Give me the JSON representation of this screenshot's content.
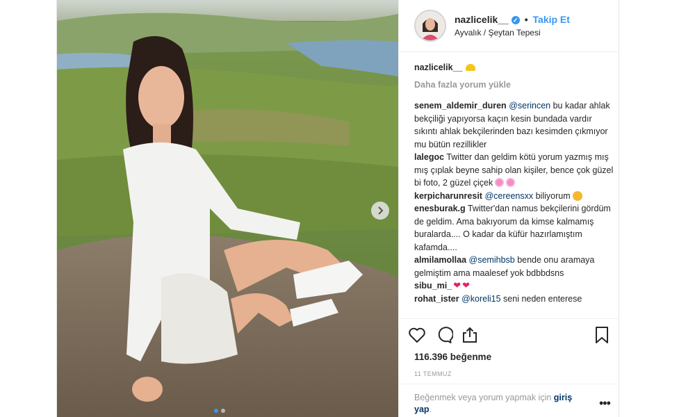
{
  "header": {
    "username": "nazlicelik__",
    "separator": "•",
    "follow_label": "Takip Et",
    "location": "Ayvalık / Şeytan Tepesi"
  },
  "caption": {
    "username": "nazlicelik__"
  },
  "load_more_label": "Daha fazla yorum yükle",
  "comments": [
    {
      "username": "senem_aldemir_duren",
      "mention": "@serincen",
      "text": " bu kadar ahlak bekçiliği yapıyorsa kaçın kesin bundada vardır sıkıntı ahlak bekçilerinden bazı kesimden çıkmıyor mu bütün rezillikler"
    },
    {
      "username": "lalegoc",
      "mention": "",
      "text": "Twitter dan geldim kötü yorum yazmış mış mış çıplak beyne sahip olan kişiler, bence çok güzel bi foto, 2 güzel çiçek"
    },
    {
      "username": "kerpicharunresit",
      "mention": "@cereensxx",
      "text": " biliyorum"
    },
    {
      "username": "enesburak.g",
      "mention": "",
      "text": "Twitter'dan namus bekçilerini gördüm de geldim. Ama bakıyorum da kimse kalmamış buralarda.... O kadar da küfür hazırlamıştım kafamda...."
    },
    {
      "username": "almilamollaa",
      "mention": "@semihbsb",
      "text": " bende onu aramaya gelmiştim ama maalesef yok bdbbdsns"
    },
    {
      "username": "sibu_mi_",
      "mention": "",
      "text": ""
    },
    {
      "username": "rohat_ister",
      "mention": "@koreli15",
      "text": " seni neden enterese"
    }
  ],
  "likes": "116.396 beğenme",
  "date": "11 TEMMUZ",
  "footer": {
    "text": "Beğenmek veya yorum yapmak için ",
    "login_label": "giriş yap",
    "end": "."
  },
  "icons": {
    "like": "heart-outline-icon",
    "comment": "comment-icon",
    "share": "share-icon",
    "save": "bookmark-icon",
    "more": "more-options-icon",
    "next": "chevron-right-icon",
    "verified": "verified-badge-icon"
  },
  "colors": {
    "accent": "#3897f0",
    "text": "#262626",
    "muted": "#999999",
    "link": "#003569"
  },
  "carousel": {
    "total": 2,
    "active": 1
  }
}
